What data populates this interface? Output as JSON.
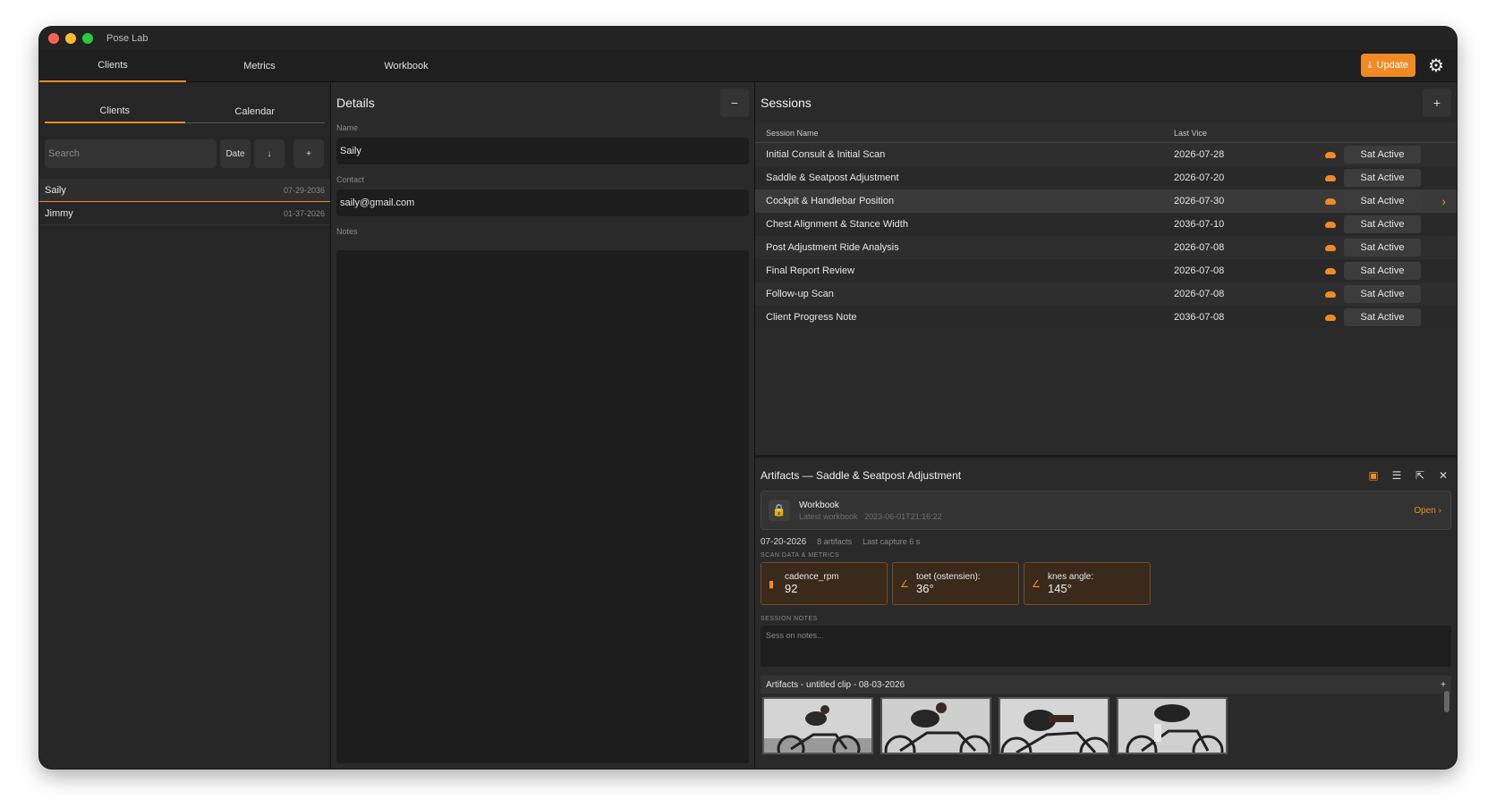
{
  "app": {
    "title": "Pose Lab"
  },
  "topnav": {
    "tabs": [
      {
        "label": "Clients",
        "active": true
      },
      {
        "label": "Metrics",
        "active": false
      },
      {
        "label": "Workbook",
        "active": false
      }
    ],
    "update_label": "Update",
    "accent": "#f08a24"
  },
  "left": {
    "subtabs": [
      {
        "label": "Clients",
        "active": true
      },
      {
        "label": "Calendar",
        "active": false
      }
    ],
    "search": {
      "placeholder": "Search"
    },
    "sort_label": "Date",
    "clients": [
      {
        "name": "Saily",
        "date": "07-29-2036",
        "active": true
      },
      {
        "name": "Jimmy",
        "date": "01-37-2026",
        "active": false
      }
    ]
  },
  "details": {
    "title": "Details",
    "name_label": "Name",
    "name_value": "Saily",
    "contact_label": "Contact",
    "contact_value": "saily@gmail.com",
    "notes_label": "Notes"
  },
  "sessions": {
    "title": "Sessions",
    "columns": [
      "Session Name",
      "Last Vice"
    ],
    "rows": [
      {
        "name": "Initial Consult & Initial Scan",
        "date": "2026-07-28",
        "status": "Sat Active"
      },
      {
        "name": "Saddle & Seatpost Adjustment",
        "date": "2026-07-20",
        "status": "Sat Active"
      },
      {
        "name": "Cockpit & Handlebar Position",
        "date": "2026-07-30",
        "status": "Sat Active"
      },
      {
        "name": "Chest Alignment & Stance Width",
        "date": "2036-07-10",
        "status": "Sat Active"
      },
      {
        "name": "Post Adjustment Ride Analysis",
        "date": "2026-07-08",
        "status": "Sat Active"
      },
      {
        "name": "Final Report Review",
        "date": "2026-07-08",
        "status": "Sat Active"
      },
      {
        "name": "Follow-up Scan",
        "date": "2026-07-08",
        "status": "Sat Active"
      },
      {
        "name": "Client Progress Note",
        "date": "2036-07-08",
        "status": "Sat Active"
      }
    ]
  },
  "artifacts": {
    "title": "Artifacts — Saddle & Seatpost Adjustment",
    "workbook": {
      "title": "Workbook",
      "subtitle": "Latest workbook",
      "timestamp": "2023-06-01T21:16:22",
      "open_label": "Open"
    },
    "meta": {
      "date": "07-20-2026",
      "count": "8 artifacts",
      "last_capture": "Last capture 6 s"
    },
    "metrics_section": "SCAN DATA & METRICS",
    "metrics": [
      {
        "label": "cadence_rpm",
        "value": "92"
      },
      {
        "label": "toet (ostensien):",
        "value": "36°"
      },
      {
        "label": "knes angle:",
        "value": "145°"
      }
    ],
    "notes_section": "SESSION NOTES",
    "notes_placeholder": "Sess on notes...",
    "clip_title": "Artifacts - untitled clip - 08-03-2026",
    "clip_toggle": "+"
  }
}
